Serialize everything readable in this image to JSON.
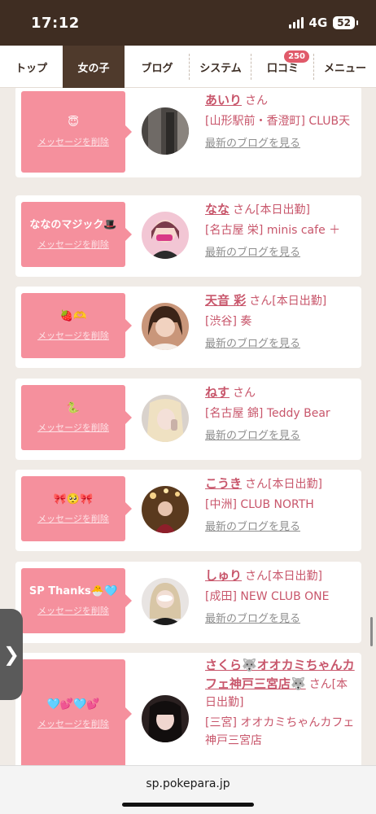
{
  "status": {
    "time": "17:12",
    "network": "4G",
    "battery": "52"
  },
  "nav": {
    "tabs": [
      {
        "label": "トップ"
      },
      {
        "label": "女の子"
      },
      {
        "label": "ブログ"
      },
      {
        "label": "システム"
      },
      {
        "label": "口コミ",
        "badge": "250"
      },
      {
        "label": "メニュー"
      }
    ]
  },
  "delete_label": "メッセージを削除",
  "blog_label": "最新のブログを見る",
  "cards": [
    {
      "message": "😇",
      "name": "あいり",
      "san": "さん",
      "shop": "[山形駅前・香澄町] CLUB天"
    },
    {
      "message": "ななのマジック🎩",
      "name": "なな",
      "san": "さん[本日出勤]",
      "shop": "[名古屋 栄] minis cafe ＋"
    },
    {
      "message": "🍓🫶",
      "name": "天音 彩",
      "san": "さん[本日出勤]",
      "shop": "[渋谷] 奏"
    },
    {
      "message": "🐍",
      "name": "ねす",
      "san": "さん",
      "shop": "[名古屋 錦] Teddy Bear"
    },
    {
      "message": "🎀🥺🎀",
      "name": "こうき",
      "san": "さん[本日出勤]",
      "shop": "[中洲] CLUB NORTH"
    },
    {
      "message": "SP Thanks🐣🩵",
      "name": "しゅり",
      "san": "さん[本日出勤]",
      "shop": "[成田] NEW CLUB ONE"
    },
    {
      "message": "🩵💕🩵💕",
      "name": "さくら🐺オオカミちゃんカフェ神戸三宮店🐺",
      "san": "さん[本日出勤]",
      "shop": "[三宮] オオカミちゃんカフェ神戸三宮店"
    }
  ],
  "side_toggle": "❯",
  "url": "sp.pokepara.jp"
}
